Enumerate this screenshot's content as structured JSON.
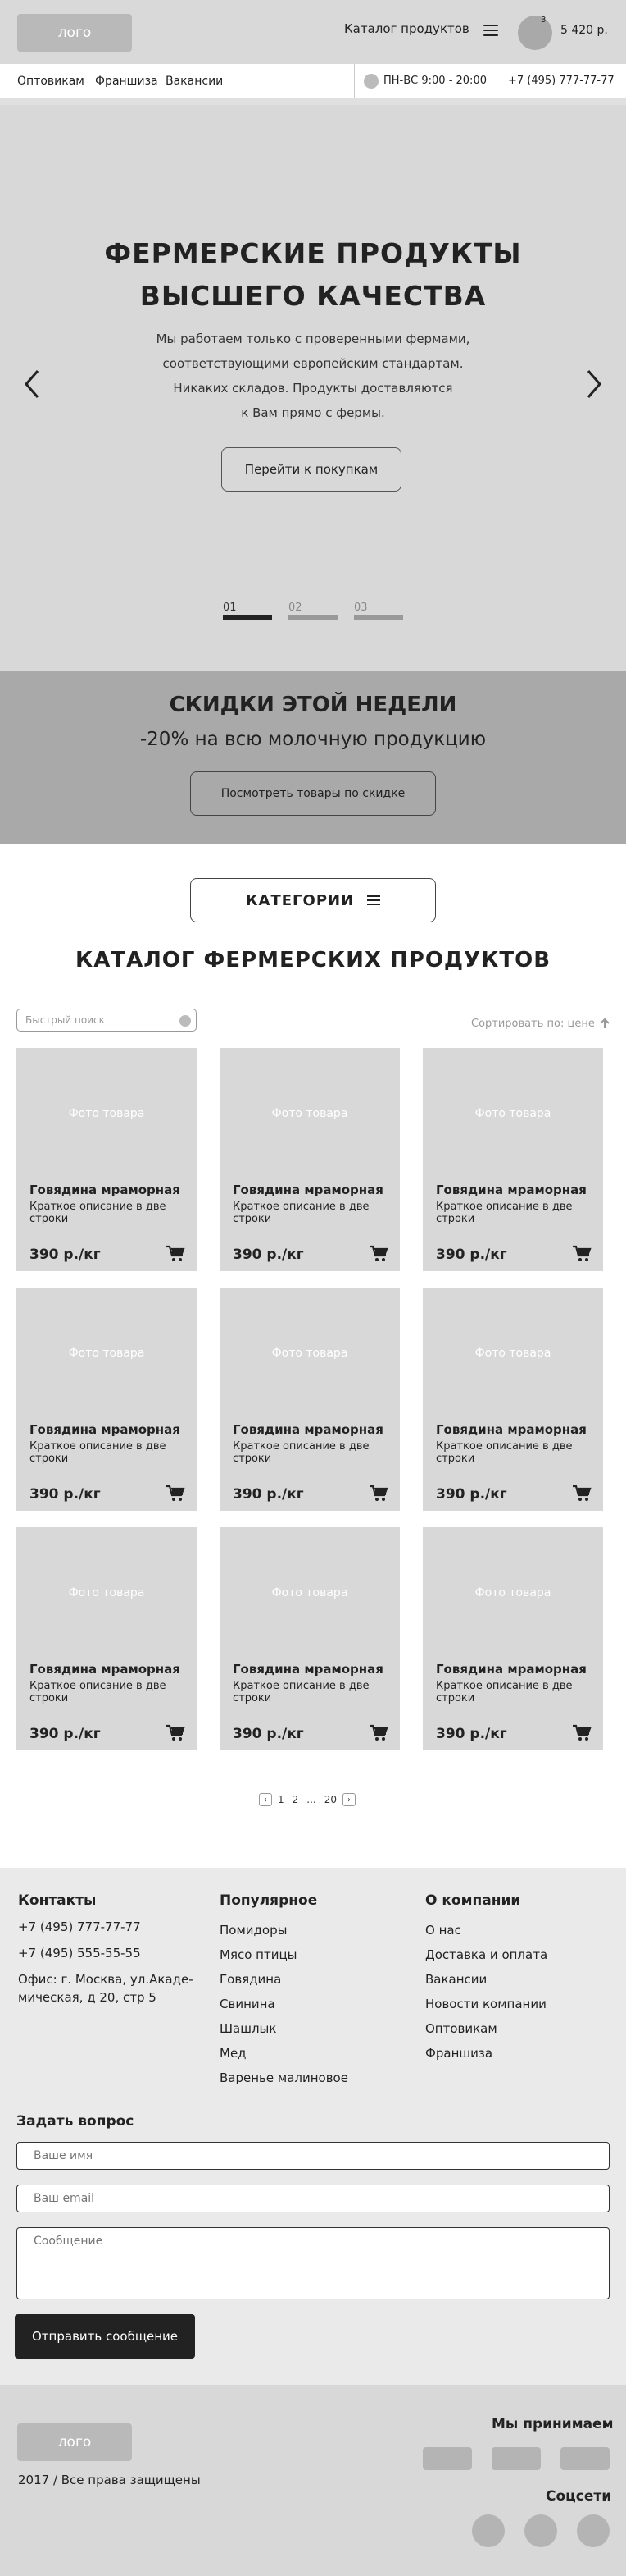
{
  "header": {
    "logo": "лого",
    "catalog_link": "Каталог продуктов",
    "cart_count": "3",
    "cart_total": "5 420 р."
  },
  "nav": {
    "links": [
      "Оптовикам",
      "Франшиза",
      "Вакансии"
    ],
    "hours": "ПН-ВС 9:00 - 20:00",
    "phone": "+7 (495) 777-77-77"
  },
  "hero": {
    "title_line1": "ФЕРМЕРСКИЕ ПРОДУКТЫ",
    "title_line2": "ВЫСШЕГО КАЧЕСТВА",
    "text_lines": [
      "Мы работаем только с проверенными фермами,",
      "соответствующими европейским стандартам.",
      "Никаких складов. Продукты доставляются",
      "к Вам прямо с фермы."
    ],
    "button": "Перейти к покупкам",
    "slides": [
      "01",
      "02",
      "03"
    ],
    "active_slide": 0
  },
  "discount": {
    "title": "СКИДКИ ЭТОЙ НЕДЕЛИ",
    "subtitle": "-20% на всю молочную продукцию",
    "button": "Посмотреть товары по скидке"
  },
  "catalog": {
    "categories_button": "КАТЕГОРИИ",
    "title": "КАТАЛОГ ФЕРМЕРСКИХ ПРОДУКТОВ",
    "search_placeholder": "Быстрый поиск",
    "sort_label": "Сортировать по: цене",
    "products": [
      {
        "photo": "Фото товара",
        "name": "Говядина мраморная",
        "description": "Краткое описание в две строки",
        "price": "390 р./кг"
      },
      {
        "photo": "Фото товара",
        "name": "Говядина мраморная",
        "description": "Краткое описание в две строки",
        "price": "390 р./кг"
      },
      {
        "photo": "Фото товара",
        "name": "Говядина мраморная",
        "description": "Краткое описание в две строки",
        "price": "390 р./кг"
      },
      {
        "photo": "Фото товара",
        "name": "Говядина мраморная",
        "description": "Краткое описание в две строки",
        "price": "390 р./кг"
      },
      {
        "photo": "Фото товара",
        "name": "Говядина мраморная",
        "description": "Краткое описание в две строки",
        "price": "390 р./кг"
      },
      {
        "photo": "Фото товара",
        "name": "Говядина мраморная",
        "description": "Краткое описание в две строки",
        "price": "390 р./кг"
      },
      {
        "photo": "Фото товара",
        "name": "Говядина мраморная",
        "description": "Краткое описание в две строки",
        "price": "390 р./кг"
      },
      {
        "photo": "Фото товара",
        "name": "Говядина мраморная",
        "description": "Краткое описание в две строки",
        "price": "390 р./кг"
      },
      {
        "photo": "Фото товара",
        "name": "Говядина мраморная",
        "description": "Краткое описание в две строки",
        "price": "390 р./кг"
      }
    ],
    "pagination": {
      "pages": [
        "1",
        "2",
        "...",
        "20"
      ]
    }
  },
  "footer": {
    "contacts": {
      "title": "Контакты",
      "phone1": "+7 (495) 777-77-77",
      "phone2": "+7 (495) 555-55-55",
      "address_line1": "Офис: г. Москва, ул.Акаде-",
      "address_line2": "мическая, д 20, стр 5"
    },
    "popular": {
      "title": "Популярное",
      "items": [
        "Помидоры",
        "Мясо птицы",
        "Говядина",
        "Свинина",
        "Шашлык",
        "Мед",
        "Варенье малиновое"
      ]
    },
    "company": {
      "title": "О компании",
      "items": [
        "О нас",
        "Доставка и оплата",
        "Вакансии",
        "Новости компании",
        "Оптовикам",
        "Франшиза"
      ]
    },
    "form": {
      "title": "Задать вопрос",
      "name_placeholder": "Ваше имя",
      "email_placeholder": "Ваш email",
      "message_placeholder": "Сообщение",
      "submit": "Отправить сообщение"
    },
    "bottom": {
      "logo": "лого",
      "copyright": "2017 / Все права защищены",
      "payments_title": "Мы принимаем",
      "social_title": "Соцсети"
    }
  },
  "colors": {
    "header_bg": "#d9d9d9",
    "hero_bg": "#d8d8d8",
    "discount_bg": "#a9a9a9",
    "footer_bg": "#ebeaeb",
    "button_dark": "#222222"
  }
}
